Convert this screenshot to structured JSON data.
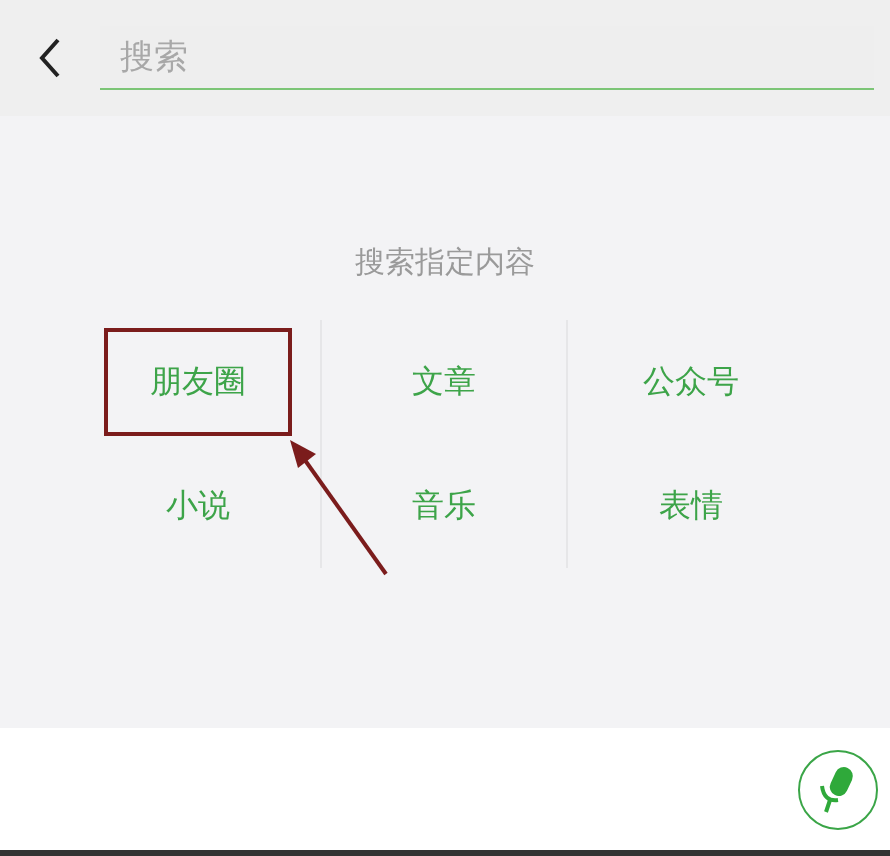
{
  "search": {
    "placeholder": "搜索"
  },
  "section_title": "搜索指定内容",
  "categories": [
    {
      "label": "朋友圈",
      "highlighted": true
    },
    {
      "label": "文章",
      "highlighted": false
    },
    {
      "label": "公众号",
      "highlighted": false
    },
    {
      "label": "小说",
      "highlighted": false
    },
    {
      "label": "音乐",
      "highlighted": false
    },
    {
      "label": "表情",
      "highlighted": false
    }
  ]
}
